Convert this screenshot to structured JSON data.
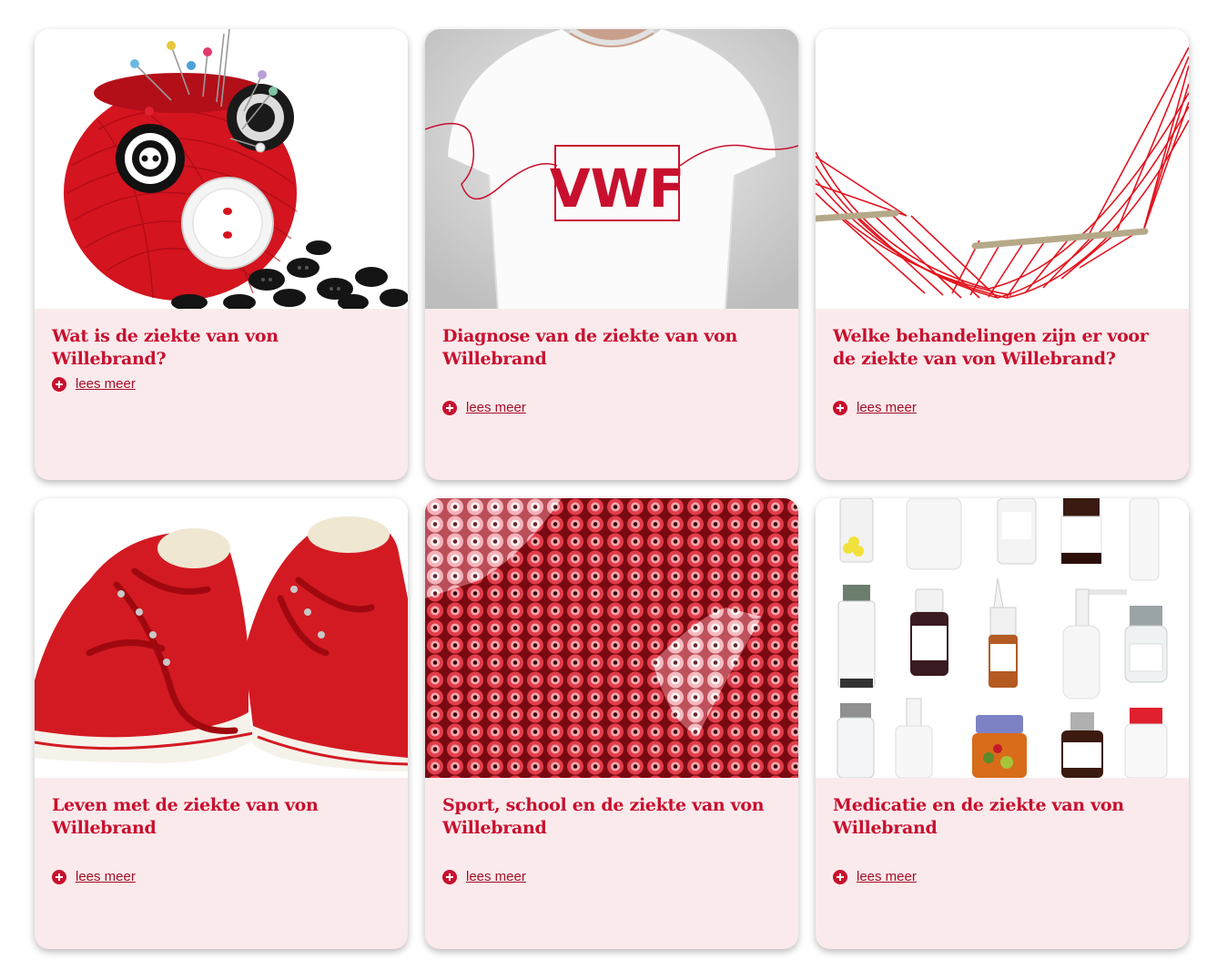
{
  "colors": {
    "accent": "#c8102e",
    "card_background": "#fbeaec",
    "link": "#a50d26"
  },
  "cards": [
    {
      "title": "Wat is de ziekte van von Willebrand?",
      "image": "red-yarn-ball-buttons",
      "link_label": "lees meer",
      "link_icon": "plus-circle-icon"
    },
    {
      "title": "Diagnose van de ziekte van von Willebrand",
      "image": "white-tshirt-vwf",
      "image_text": "VWF",
      "link_label": "lees meer",
      "link_icon": "plus-circle-icon"
    },
    {
      "title": "Welke behandelingen zijn er voor de ziekte van von Willebrand?",
      "image": "red-hammock",
      "link_label": "lees meer",
      "link_icon": "plus-circle-icon"
    },
    {
      "title": "Leven met de ziekte van von Willebrand",
      "image": "red-sneakers",
      "link_label": "lees meer",
      "link_icon": "plus-circle-icon"
    },
    {
      "title": "Sport, school en de ziekte van von Willebrand",
      "image": "red-thread-spools",
      "link_label": "lees meer",
      "link_icon": "plus-circle-icon"
    },
    {
      "title": "Medicatie en de ziekte van von Willebrand",
      "image": "medicine-bottles",
      "link_label": "lees meer",
      "link_icon": "plus-circle-icon"
    }
  ]
}
